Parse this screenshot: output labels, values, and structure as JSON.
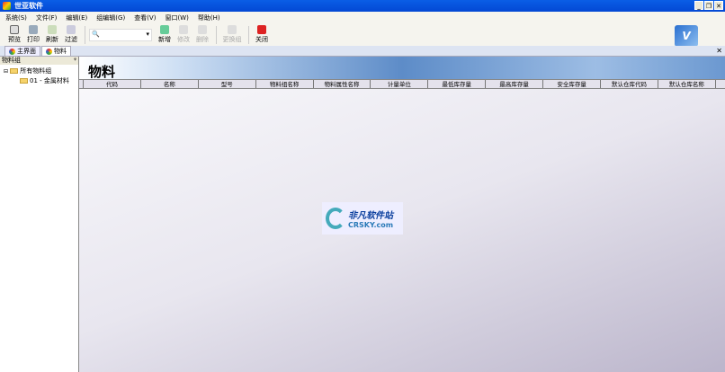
{
  "window": {
    "title": "世亚软件"
  },
  "menu": [
    "系统(S)",
    "文件(F)",
    "编辑(E)",
    "组编辑(G)",
    "查看(V)",
    "窗口(W)",
    "帮助(H)"
  ],
  "toolbar": {
    "preview": "预览",
    "print": "打印",
    "refresh": "刷新",
    "filter": "过滤",
    "search_value": "",
    "add": "新增",
    "edit": "修改",
    "delete": "删除",
    "change_group": "更换组",
    "close": "关闭"
  },
  "tabs": [
    "主界面",
    "物料"
  ],
  "left_panel": {
    "title": "物料组",
    "pin": "ᵠ",
    "root": "所有物料组",
    "child": "01 - 金属材料"
  },
  "main": {
    "title": "物料",
    "columns": [
      "代码",
      "名称",
      "型号",
      "物料组名称",
      "物料属性名称",
      "计量单位",
      "最低库存量",
      "最高库存量",
      "安全库存量",
      "默认仓库代码",
      "默认仓库名称"
    ]
  },
  "watermark": {
    "line1": "非凡软件站",
    "line2": "CRSKY.com"
  },
  "logo": "V"
}
